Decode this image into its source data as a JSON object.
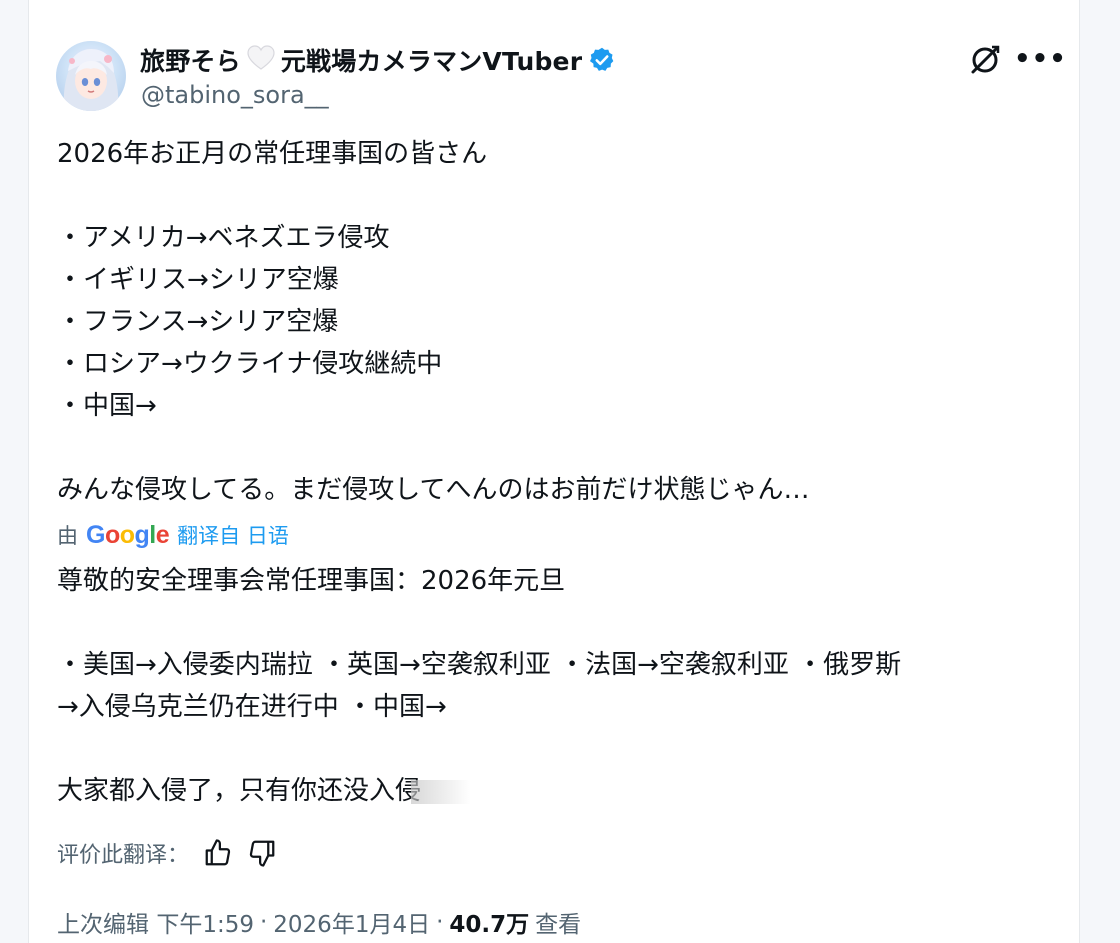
{
  "author": {
    "display_name": "旅野そら🤍元戦場カメラマンVTuber",
    "name_before": "旅野そら",
    "name_after": "元戦場カメラマンVTuber",
    "handle": "@tabino_sora__",
    "verified": true
  },
  "tweet": {
    "lines": [
      "2026年お正月の常任理事国の皆さん",
      "",
      "・アメリカ→ベネズエラ侵攻",
      "・イギリス→シリア空爆",
      "・フランス→シリア空爆",
      "・ロシア→ウクライナ侵攻継続中",
      "・中国→",
      "",
      "みんな侵攻してる。まだ侵攻してへんのはお前だけ状態じゃん…"
    ]
  },
  "translation": {
    "prefix": "由",
    "provider": "Google",
    "translated_from": "翻译自 日语",
    "lines": [
      "尊敬的安全理事会常任理事国：2026年元旦",
      "",
      "・美国→入侵委内瑞拉 ・英国→空袭叙利亚 ・法国→空袭叙利亚 ・俄罗斯",
      "→入侵乌克兰仍在进行中 ・中国→",
      "",
      "大家都入侵了，只有你还没入侵"
    ],
    "rate_label": "评价此翻译："
  },
  "meta": {
    "edited": "上次编辑",
    "time": "下午1:59",
    "date": "2026年1月4日",
    "views": "40.7万",
    "views_label": "查看",
    "separator": "·"
  },
  "colors": {
    "accent": "#1d9bf0",
    "secondary_text": "#536471",
    "primary_text": "#0f1419"
  }
}
